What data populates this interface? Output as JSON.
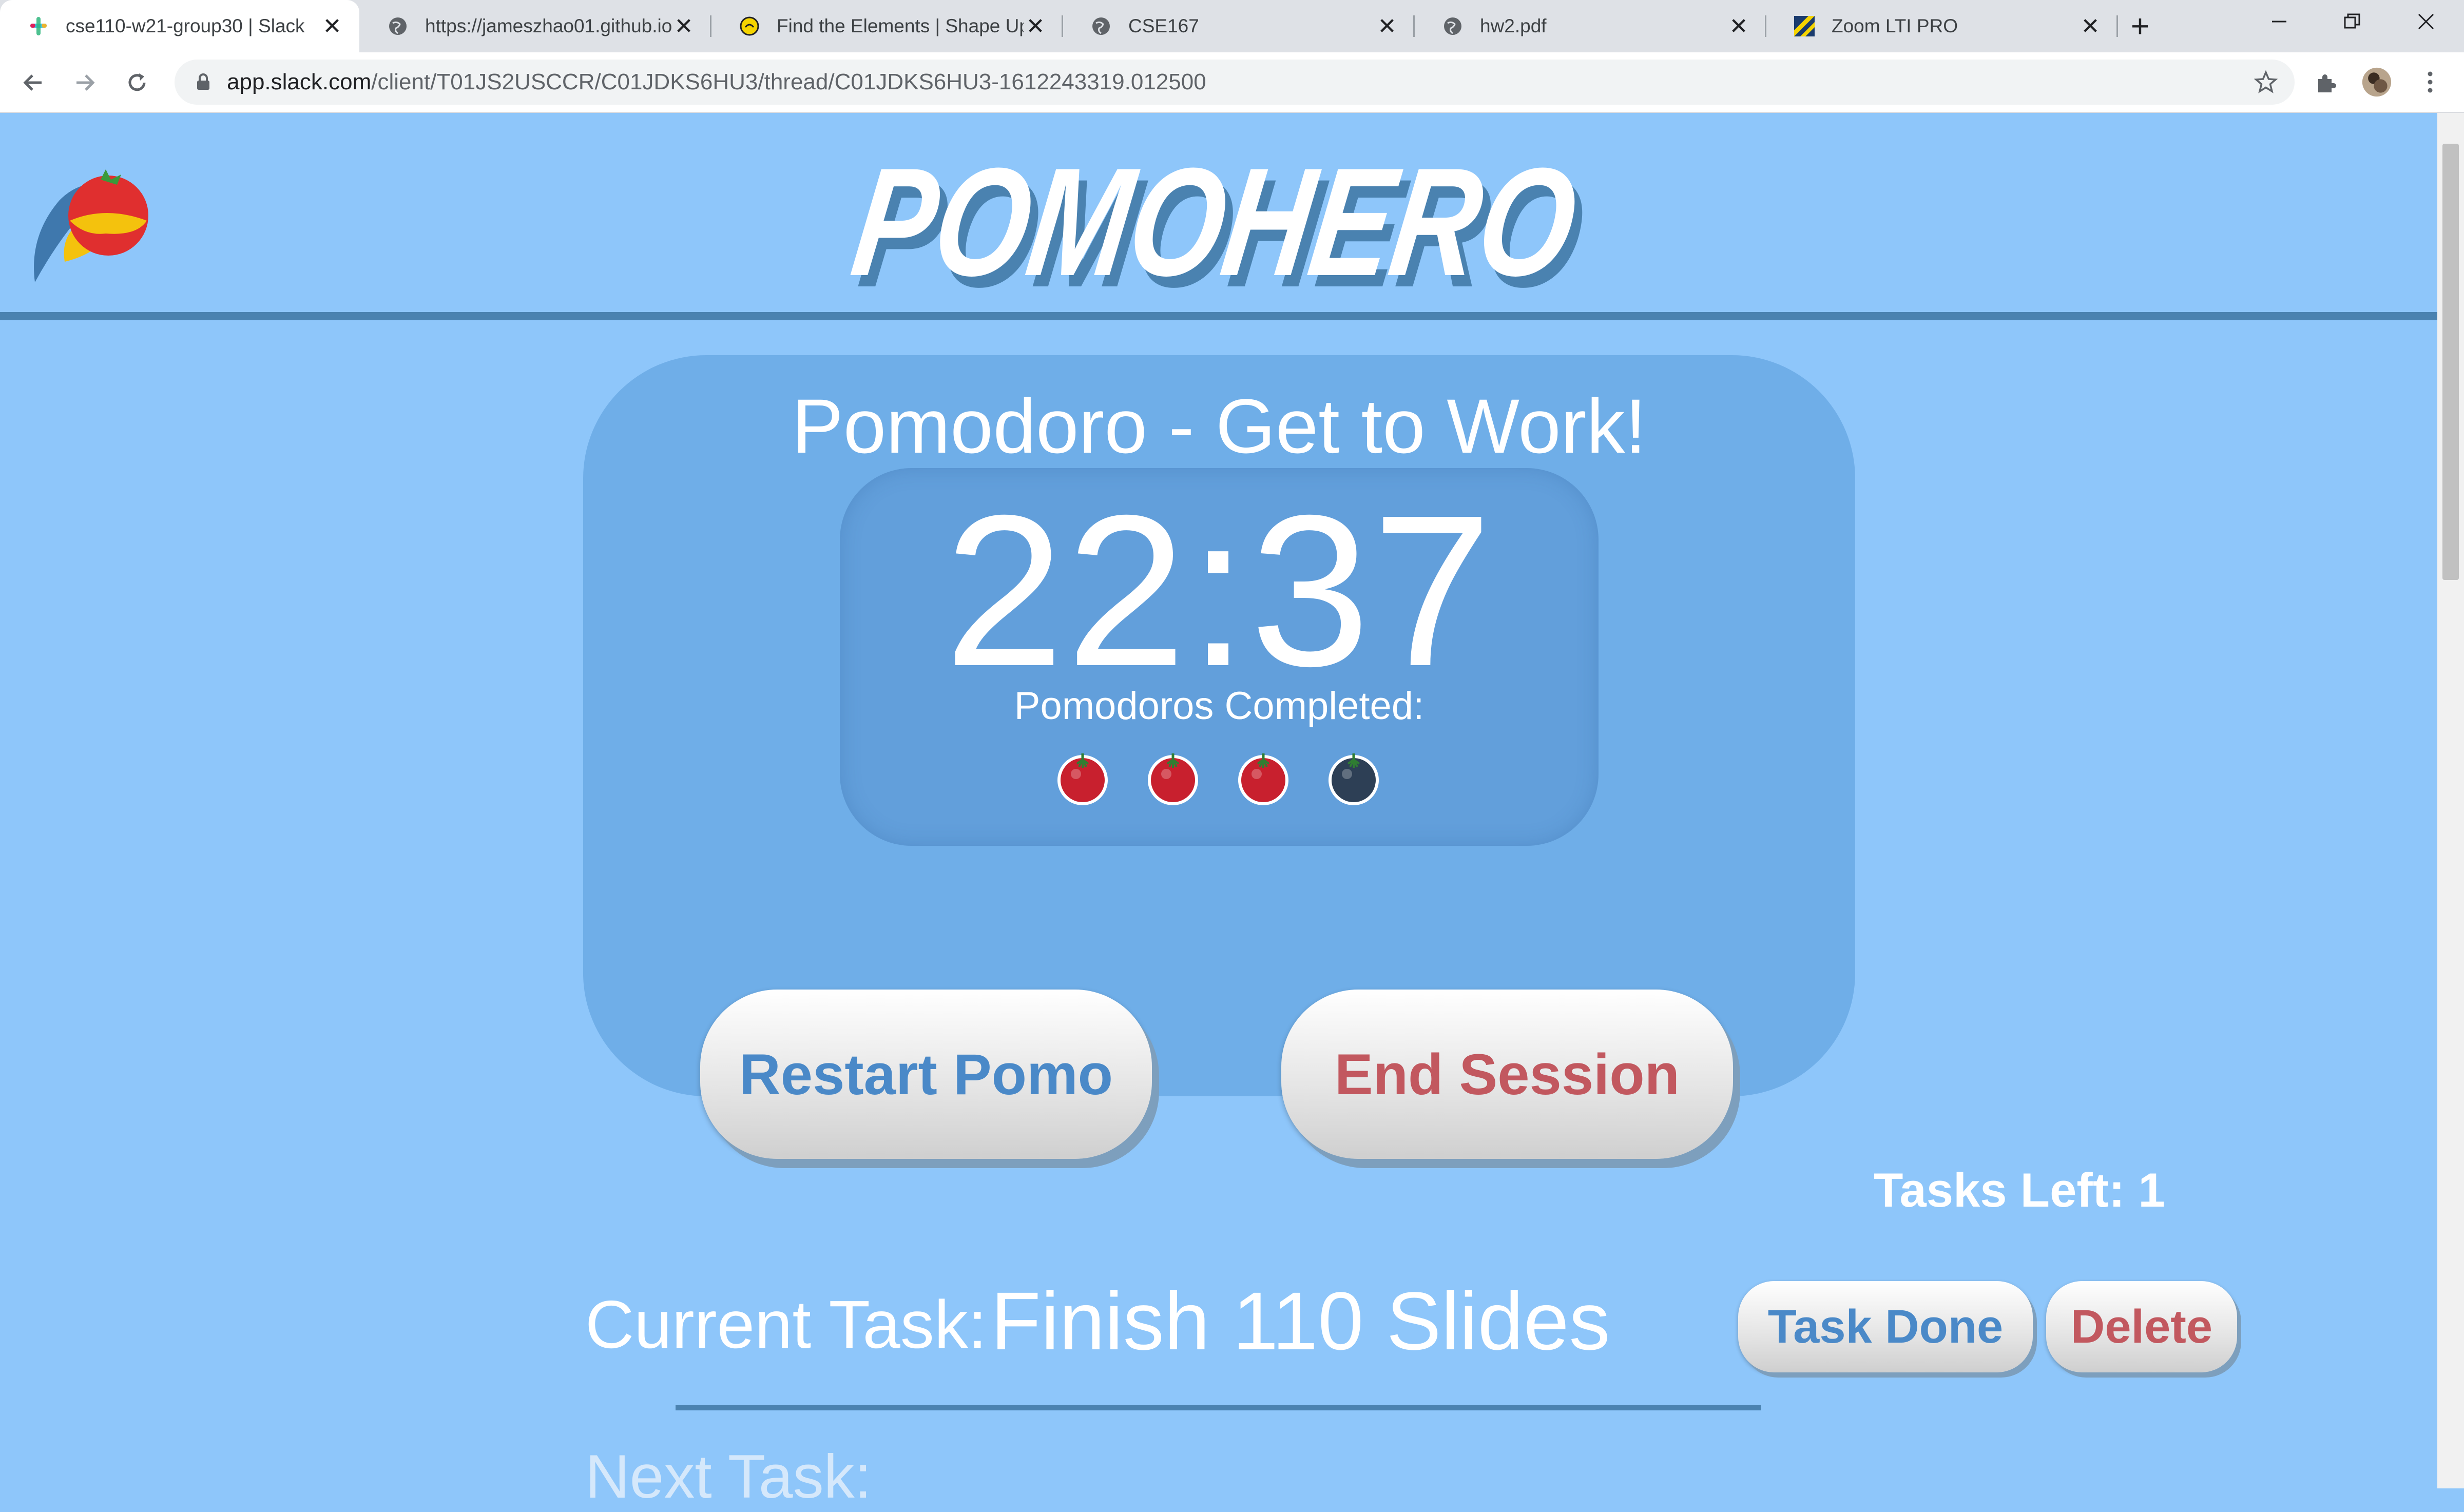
{
  "browser": {
    "tabs": [
      {
        "title": "cse110-w21-group30 | Slack",
        "icon": "slack-icon",
        "active": true
      },
      {
        "title": "https://jameszhao01.github.io",
        "icon": "globe-icon",
        "active": false
      },
      {
        "title": "Find the Elements | Shape Up",
        "icon": "shapeup-icon",
        "active": false
      },
      {
        "title": "CSE167",
        "icon": "globe-icon",
        "active": false
      },
      {
        "title": "hw2.pdf",
        "icon": "globe-icon",
        "active": false
      },
      {
        "title": "Zoom LTI PRO",
        "icon": "zoom-icon",
        "active": false
      }
    ],
    "new_tab_label": "+",
    "url_host": "app.slack.com",
    "url_path": "/client/T01JS2USCCR/C01JDKS6HU3/thread/C01JDKS6HU3-1612243319.012500"
  },
  "app": {
    "brand": "POMOHERO",
    "mode_title": "Pomodoro - Get to Work!",
    "timer": "22:37",
    "completed_label": "Pomodoros Completed:",
    "pomodoros": {
      "completed": 3,
      "total": 4
    },
    "restart_label": "Restart Pomo",
    "end_label": "End Session",
    "tasks_left": "Tasks Left: 1",
    "current_task_label": "Current Task:",
    "current_task": "Finish 110 Slides",
    "task_done_label": "Task Done",
    "delete_label": "Delete",
    "next_task_label": "Next Task:"
  },
  "colors": {
    "background": "#8ec6fa",
    "panel": "#6faee8",
    "clock_box": "#629fdb",
    "header_line": "#4a82b0",
    "primary_button_text": "#4a89c8",
    "danger_button_text": "#c2585f",
    "tomato_done": "#c8202e",
    "tomato_pending": "#2d3f55"
  }
}
